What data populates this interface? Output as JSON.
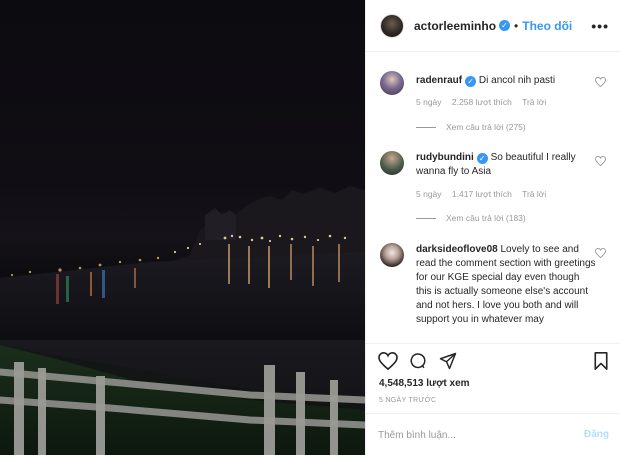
{
  "post": {
    "username": "actorleeminho",
    "follow_label": "Theo dõi",
    "more_label": "•••",
    "views": "4,548,513 lượt xem",
    "date": "5 NGÀY TRƯỚC",
    "add_comment_placeholder": "Thêm bình luận...",
    "post_label": "Đăng"
  },
  "comments": [
    {
      "username": "radenrauf",
      "text": "Di ancol nih pasti",
      "time": "5 ngày",
      "likes": "2.258 lượt thích",
      "reply_label": "Trả lời",
      "view_replies": "Xem câu trả lời (275)"
    },
    {
      "username": "rudybundini",
      "text": "So beautiful I really wanna fly to Asia",
      "time": "5 ngày",
      "likes": "1.417 lượt thích",
      "reply_label": "Trả lời",
      "view_replies": "Xem câu trả lời (183)"
    },
    {
      "username": "darksideoflove08",
      "text": "Lovely to see and read the comment section with greetings for our KGE special day even though this is actually someone else's account and not hers. I love you both and will support you in whatever may"
    }
  ],
  "icons": {
    "verified": "verified-badge-icon",
    "heart": "heart-icon",
    "comment": "comment-icon",
    "share": "share-icon",
    "bookmark": "bookmark-icon"
  },
  "colors": {
    "accent": "#3897f0",
    "muted": "#999999",
    "text": "#262626"
  }
}
